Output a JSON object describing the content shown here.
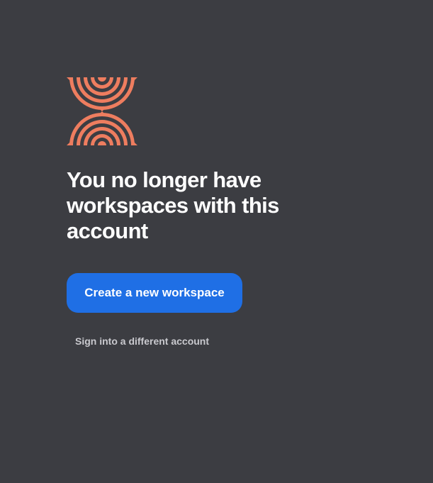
{
  "colors": {
    "background": "#3c3d42",
    "logo": "#ee7d5f",
    "primary_button": "#1f6fe5",
    "headline": "#ffffff",
    "secondary_link": "#c9c9ce"
  },
  "logo": {
    "icon": "hourglass-arches-logo"
  },
  "headline": "You no longer have workspaces with this account",
  "actions": {
    "create_workspace_label": "Create a new workspace",
    "sign_in_other_label": "Sign into a different account"
  }
}
